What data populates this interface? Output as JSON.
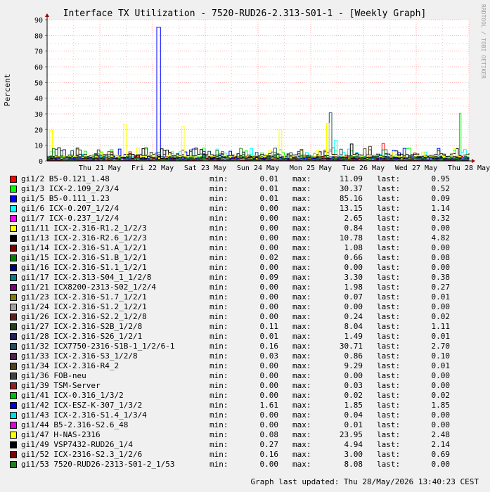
{
  "chart_data": {
    "type": "line",
    "title": "Interface TX Utilization - 7520-RUD26-2.313-S01-1 - [Weekly Graph]",
    "ylabel": "Percent",
    "xlabel": "",
    "ylim": [
      0,
      90
    ],
    "yticks": [
      0,
      10,
      20,
      30,
      40,
      50,
      60,
      70,
      80,
      90
    ],
    "xticks": [
      "Thu 21 May",
      "Fri 22 May",
      "Sat 23 May",
      "Sun 24 May",
      "Mon 25 May",
      "Tue 26 May",
      "Wed 27 May",
      "Thu 28 May"
    ],
    "x_range_days": [
      0,
      8
    ],
    "grid": true,
    "legend_placement": "bottom",
    "series": [
      {
        "name": "gi1/2 B5-0.121_1.48",
        "color": "#ff0000",
        "min": "0.01",
        "max": "11.09",
        "last": "0.95"
      },
      {
        "name": "gi1/3 ICX-2.109_2/3/4",
        "color": "#00ff00",
        "min": "0.01",
        "max": "30.37",
        "last": "0.52"
      },
      {
        "name": "gi1/5 B5-0.111_1.23",
        "color": "#0000ff",
        "min": "0.01",
        "max": "85.16",
        "last": "0.09"
      },
      {
        "name": "gi1/6 ICX-0.207_1/2/4",
        "color": "#00ffff",
        "min": "0.00",
        "max": "13.15",
        "last": "1.14"
      },
      {
        "name": "gi1/7 ICX-0.237_1/2/4",
        "color": "#ff00ff",
        "min": "0.00",
        "max": "2.65",
        "last": "0.32"
      },
      {
        "name": "gi1/11 ICX-2.316-R1.2_1/2/3",
        "color": "#ffff00",
        "min": "0.00",
        "max": "0.84",
        "last": "0.00"
      },
      {
        "name": "gi1/13 ICX-2.316-R2.6_1/2/3",
        "color": "#000000",
        "min": "0.00",
        "max": "10.78",
        "last": "4.82"
      },
      {
        "name": "gi1/14 ICX-2.316-S1.A_1/2/1",
        "color": "#800000",
        "min": "0.00",
        "max": "1.08",
        "last": "0.00"
      },
      {
        "name": "gi1/15 ICX-2.316-S1.B_1/2/1",
        "color": "#008000",
        "min": "0.02",
        "max": "0.66",
        "last": "0.08"
      },
      {
        "name": "gi1/16 ICX-2.316-S1.1_1/2/1",
        "color": "#000080",
        "min": "0.00",
        "max": "0.00",
        "last": "0.00"
      },
      {
        "name": "gi1/17 ICX-2.313-S04_1_1/2/8",
        "color": "#008080",
        "min": "0.09",
        "max": "3.30",
        "last": "0.38"
      },
      {
        "name": "gi1/21 ICX8200-2313-S02_1/2/4",
        "color": "#800080",
        "min": "0.00",
        "max": "1.98",
        "last": "0.27"
      },
      {
        "name": "gi1/23 ICX-2.316-S1.7_1/2/1",
        "color": "#808000",
        "min": "0.00",
        "max": "0.07",
        "last": "0.01"
      },
      {
        "name": "gi1/24 ICX-2.316-S1.2_1/2/1",
        "color": "#a0a0a0",
        "min": "0.00",
        "max": "0.00",
        "last": "0.00"
      },
      {
        "name": "gi1/26 ICX-2.316-S2.2_1/2/8",
        "color": "#602020",
        "min": "0.00",
        "max": "0.24",
        "last": "0.02"
      },
      {
        "name": "gi1/27 ICX-2.316-S2B_1/2/8",
        "color": "#204020",
        "min": "0.11",
        "max": "8.04",
        "last": "1.11"
      },
      {
        "name": "gi1/28 ICX-2.316-S26_1/2/1",
        "color": "#202060",
        "min": "0.01",
        "max": "1.49",
        "last": "0.01"
      },
      {
        "name": "gi1/32 ICX7750-2316-S1B-1_1/2/6-1",
        "color": "#205060",
        "min": "0.16",
        "max": "30.71",
        "last": "2.70"
      },
      {
        "name": "gi1/33 ICX-2.316-S3_1/2/8",
        "color": "#502050",
        "min": "0.03",
        "max": "0.86",
        "last": "0.10"
      },
      {
        "name": "gi1/34 ICX-2.316-R4_2",
        "color": "#504020",
        "min": "0.00",
        "max": "9.29",
        "last": "0.01"
      },
      {
        "name": "gi1/36 FOB-neu",
        "color": "#404040",
        "min": "0.00",
        "max": "0.00",
        "last": "0.00"
      },
      {
        "name": "gi1/39 TSM-Server",
        "color": "#902020",
        "min": "0.00",
        "max": "0.03",
        "last": "0.00"
      },
      {
        "name": "gi1/41 ICX-0.316_1/3/2",
        "color": "#00c000",
        "min": "0.00",
        "max": "0.02",
        "last": "0.02"
      },
      {
        "name": "gi1/42 ICX-ESZ-K-307_1/3/2",
        "color": "#0000e0",
        "min": "1.61",
        "max": "1.85",
        "last": "1.85"
      },
      {
        "name": "gi1/43 ICX-2.316-S1.4_1/3/4",
        "color": "#00e0e0",
        "min": "0.00",
        "max": "0.04",
        "last": "0.00"
      },
      {
        "name": "gi1/44 B5-2.316-S2.6_48",
        "color": "#e000e0",
        "min": "0.00",
        "max": "0.01",
        "last": "0.00"
      },
      {
        "name": "gi1/47 H-NAS-2316",
        "color": "#ffff00",
        "min": "0.08",
        "max": "23.95",
        "last": "2.48"
      },
      {
        "name": "gi1/49 VSP7432-RUD26_1/4",
        "color": "#000000",
        "min": "0.27",
        "max": "4.94",
        "last": "2.14"
      },
      {
        "name": "gi1/52 ICX-2316-S2.3_1/2/6",
        "color": "#800000",
        "min": "0.16",
        "max": "3.00",
        "last": "0.69"
      },
      {
        "name": "gi1/53 7520-RUD26-2313-S01-2_1/53",
        "color": "#208020",
        "min": "0.00",
        "max": "8.08",
        "last": "0.00"
      }
    ],
    "peaks": [
      {
        "series": 2,
        "day": 2.08,
        "value": 85.16
      },
      {
        "series": 17,
        "day": 5.35,
        "value": 30.71
      },
      {
        "series": 1,
        "day": 7.82,
        "value": 30.37
      },
      {
        "series": 26,
        "day": 5.3,
        "value": 23.95
      },
      {
        "series": 26,
        "day": 1.45,
        "value": 23.5
      },
      {
        "series": 26,
        "day": 2.55,
        "value": 21.8
      },
      {
        "series": 26,
        "day": 4.4,
        "value": 19.9
      },
      {
        "series": 26,
        "day": 0.05,
        "value": 19.7
      },
      {
        "series": 3,
        "day": 5.45,
        "value": 13.15
      },
      {
        "series": 0,
        "day": 6.35,
        "value": 11.09
      },
      {
        "series": 6,
        "day": 5.75,
        "value": 10.78
      },
      {
        "series": 19,
        "day": 6.1,
        "value": 9.29
      }
    ]
  },
  "labels": {
    "min": "min:",
    "max": "max:",
    "last": "last:"
  },
  "footer": "Graph last updated: Thu 28/May/2026 13:40:23 CEST",
  "watermark": "RRDTOOL / TOBI OETIKER"
}
